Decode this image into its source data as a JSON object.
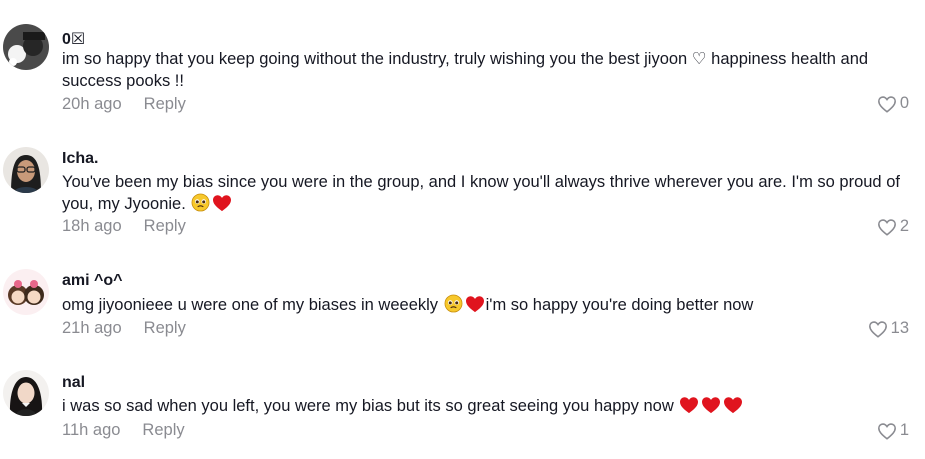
{
  "comments": [
    {
      "username": "0☒",
      "text": "im so happy that you keep going without the industry, truly wishing you the best jiyoon ♡ happiness health and success pooks !!",
      "time": "20h ago",
      "reply": "Reply",
      "likes": "0"
    },
    {
      "username": "Icha.",
      "text": "You've been my bias since you were in the group, and I know you'll always thrive wherever you are. I'm so proud of you, my Jyoonie.",
      "time": "18h ago",
      "reply": "Reply",
      "likes": "2"
    },
    {
      "username": "ami ^o^",
      "text_a": "omg jiyoonieee u were one of my biases in weeekly",
      "text_b": "i'm so happy you're doing better now",
      "time": "21h ago",
      "reply": "Reply",
      "likes": "13"
    },
    {
      "username": "nal",
      "text": "i was so sad when you left, you were my bias but its so great seeing you happy now",
      "time": "11h ago",
      "reply": "Reply",
      "likes": "1"
    }
  ],
  "icons": {
    "like": "heart-outline-icon",
    "pleading": "pleading-face-emoji",
    "heart": "red-heart-emoji"
  },
  "colors": {
    "text": "#161823",
    "muted": "#8a8b91",
    "heart": "#e0141e"
  }
}
